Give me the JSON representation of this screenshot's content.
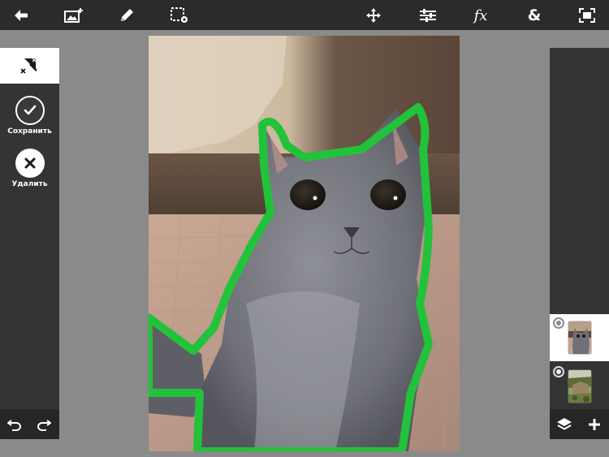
{
  "toolbar": {
    "icons": [
      "back-arrow-icon",
      "add-image-icon",
      "pencil-icon",
      "selection-settings-icon",
      "move-icon",
      "adjustments-icon",
      "fx-icon",
      "ampersand-icon",
      "fit-screen-icon"
    ],
    "fx_label": "fx",
    "ampersand_label": "&"
  },
  "left_panel": {
    "active_tool_icon": "magic-wand-eraser-icon",
    "save_label": "Сохранить",
    "delete_label": "Удалить",
    "undo_icon": "undo-icon",
    "redo_icon": "redo-icon"
  },
  "canvas": {
    "image_subject": "gray cat",
    "selection_color": "#22c23a"
  },
  "layers": {
    "items": [
      {
        "thumb": "cat-photo",
        "selected": true
      },
      {
        "thumb": "garden-photo",
        "selected": false
      }
    ],
    "layers_icon": "layers-icon",
    "add_icon": "add-layer-icon"
  },
  "colors": {
    "toolbar_bg": "#2b2b2b",
    "panel_bg": "#343434",
    "workspace_bg": "#8a8a8a",
    "accent_green": "#22c23a"
  }
}
